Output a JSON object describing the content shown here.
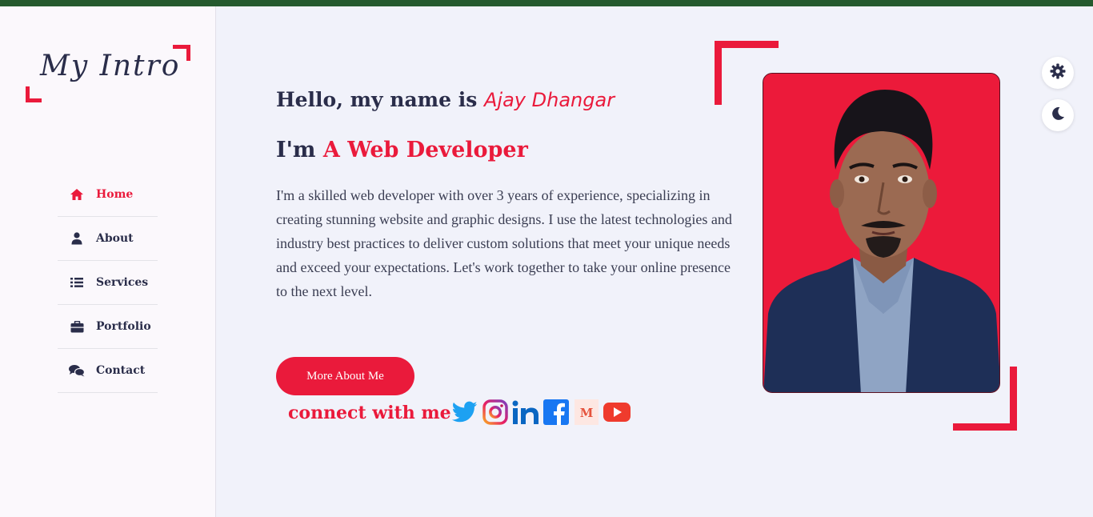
{
  "brand": {
    "logo_text": "My Intro"
  },
  "nav": {
    "items": [
      {
        "label": "Home",
        "icon": "home-icon",
        "active": true
      },
      {
        "label": "About",
        "icon": "user-icon",
        "active": false
      },
      {
        "label": "Services",
        "icon": "list-icon",
        "active": false
      },
      {
        "label": "Portfolio",
        "icon": "briefcase-icon",
        "active": false
      },
      {
        "label": "Contact",
        "icon": "chat-icon",
        "active": false
      }
    ]
  },
  "hero": {
    "greeting": "Hello, my name is",
    "name": "Ajay Dhangar",
    "role_prefix": "I'm",
    "role": "A Web Developer",
    "description": "I'm a skilled web developer with over 3 years of experience, specializing in creating stunning website and graphic designs. I use the latest technologies and industry best practices to deliver custom solutions that meet your unique needs and exceed your expectations. Let's work together to take your online presence to the next level.",
    "button_label": "More About Me",
    "connect_label": "connect with me"
  },
  "socials": [
    "twitter-icon",
    "instagram-icon",
    "linkedin-icon",
    "facebook-icon",
    "medium-icon",
    "youtube-icon"
  ],
  "controls": [
    "gear-icon",
    "moon-icon"
  ],
  "colors": {
    "accent": "#ea1a3b",
    "text": "#2a2d4a",
    "topbar": "#255a2e",
    "background": "#f1f2fa"
  }
}
